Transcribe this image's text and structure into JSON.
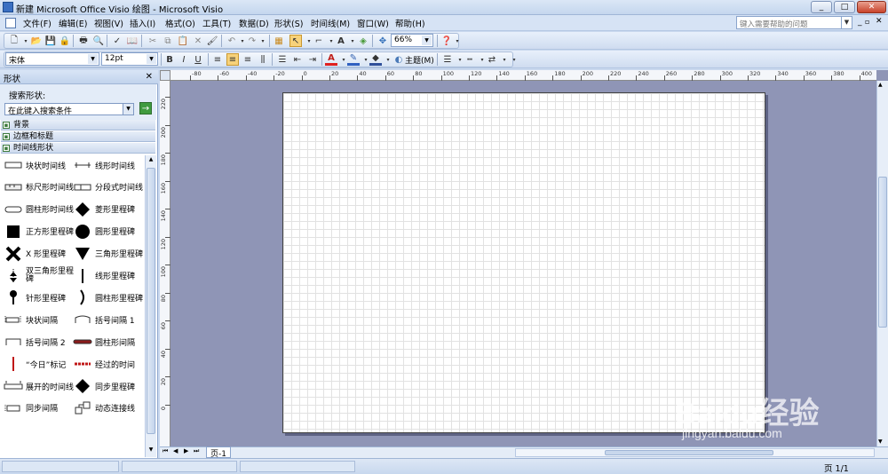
{
  "window": {
    "title": "新建 Microsoft Office Visio 绘图 - Microsoft Visio",
    "min": "_",
    "max": "□",
    "close": "✕"
  },
  "menus": [
    "文件(F)",
    "编辑(E)",
    "视图(V)",
    "插入(I)",
    "格式(O)",
    "工具(T)",
    "数据(D)",
    "形状(S)",
    "时间线(M)",
    "窗口(W)",
    "帮助(H)"
  ],
  "help": {
    "placeholder": "键入需要帮助的问题"
  },
  "toolbar": {
    "zoom": "66%"
  },
  "format": {
    "font": "宋体",
    "size": "12pt",
    "bold": "B",
    "italic": "I",
    "underline": "U",
    "theme_label": "主题(M)"
  },
  "shapes": {
    "header": "形状",
    "search_label": "搜索形状:",
    "search_placeholder": "在此键入搜索条件",
    "go": "→",
    "stencils": [
      "背景",
      "边框和标题",
      "时间线形状"
    ],
    "items": [
      "块状时间线",
      "线形时间线",
      "标尺形时间线",
      "分段式时间线",
      "圆柱形时间线",
      "菱形里程碑",
      "正方形里程碑",
      "圆形里程碑",
      "X 形里程碑",
      "三角形里程碑",
      "双三角形里程碑",
      "线形里程碑",
      "针形里程碑",
      "圆柱形里程碑",
      "块状间隔",
      "括号间隔 1",
      "括号间隔 2",
      "圆柱形间隔",
      "“今日”标记",
      "经过的时间",
      "展开的时间线",
      "同步里程碑",
      "同步间隔",
      "动态连接线"
    ]
  },
  "ruler": {
    "top": [
      "-80",
      "-60",
      "-40",
      "-20",
      "0",
      "20",
      "40",
      "60",
      "80",
      "100",
      "120",
      "140",
      "160",
      "180",
      "200",
      "220",
      "240",
      "260",
      "280",
      "300",
      "320",
      "340",
      "360",
      "380",
      "400"
    ],
    "left": [
      "220",
      "200",
      "180",
      "160",
      "140",
      "120",
      "100",
      "80",
      "60",
      "40",
      "20",
      "0"
    ]
  },
  "page_tab": "页-1",
  "status": {
    "page": "页 1/1"
  },
  "watermark": {
    "brand": "Baidu经验",
    "url": "jingyan.baidu.com"
  }
}
